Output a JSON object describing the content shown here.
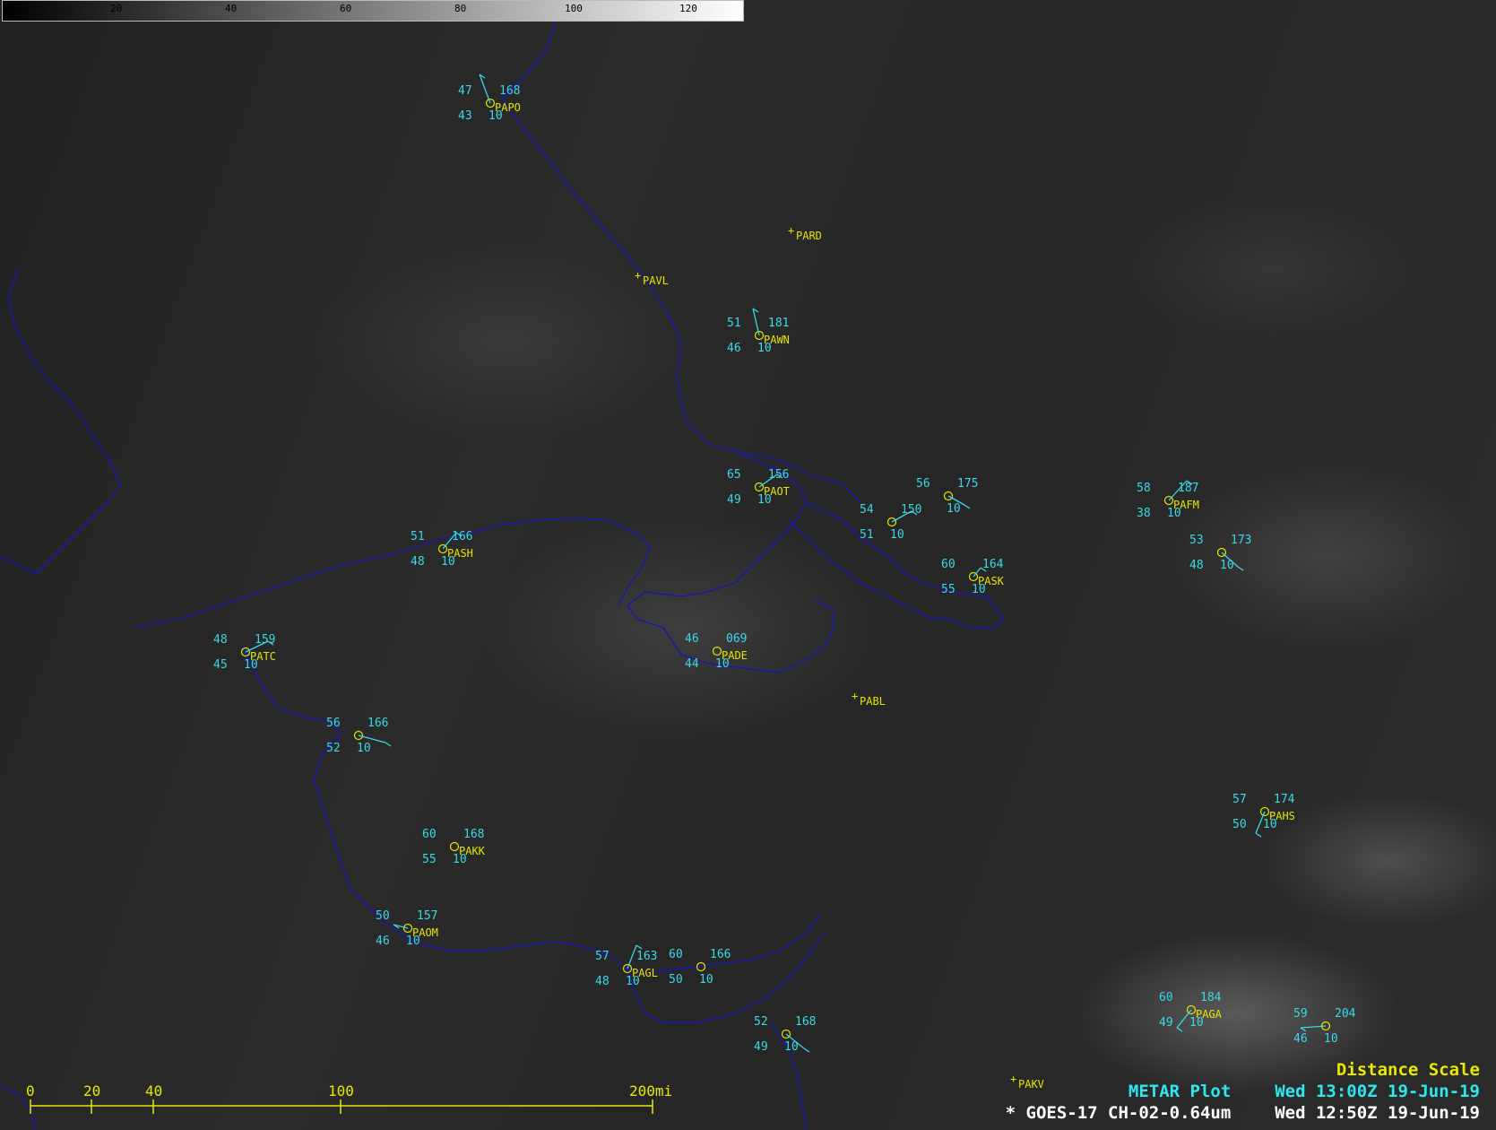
{
  "colorbar": {
    "ticks": [
      "20",
      "40",
      "60",
      "80",
      "100",
      "120"
    ]
  },
  "legend": {
    "distance_scale": "Distance Scale",
    "metar_plot": "METAR Plot",
    "metar_time": "Wed 13:00Z 19-Jun-19",
    "satellite": "* GOES-17 CH-02-0.64um",
    "satellite_time": "Wed 12:50Z 19-Jun-19"
  },
  "scale_bar": {
    "labels": [
      "0",
      "20",
      "40",
      "100",
      "200mi"
    ]
  },
  "stations": [
    {
      "id": "PAPO",
      "temp": "47",
      "dew": "43",
      "vis": "10",
      "pres": "168"
    },
    {
      "id": "PARD"
    },
    {
      "id": "PAVL"
    },
    {
      "id": "PAWN",
      "temp": "51",
      "dew": "46",
      "vis": "10",
      "pres": "181"
    },
    {
      "id": "PAOT",
      "temp": "65",
      "dew": "49",
      "vis": "10",
      "pres": "156"
    },
    {
      "temp": "56",
      "dew": "",
      "vis": "10",
      "pres": "175"
    },
    {
      "temp": "54",
      "dew": "51",
      "vis": "10",
      "pres": "150"
    },
    {
      "id": "PAFM",
      "temp": "58",
      "dew": "38",
      "vis": "10",
      "pres": "187"
    },
    {
      "temp": "53",
      "dew": "48",
      "vis": "10",
      "pres": "173"
    },
    {
      "id": "PASH",
      "temp": "51",
      "dew": "48",
      "vis": "10",
      "pres": "166"
    },
    {
      "id": "PASK",
      "temp": "60",
      "dew": "55",
      "vis": "10",
      "pres": "164"
    },
    {
      "id": "PATC",
      "temp": "48",
      "dew": "45",
      "vis": "10",
      "pres": "159"
    },
    {
      "id": "PADE",
      "temp": "46",
      "dew": "44",
      "vis": "10",
      "pres": "069"
    },
    {
      "id": "PABL"
    },
    {
      "temp": "56",
      "dew": "52",
      "vis": "10",
      "pres": "166"
    },
    {
      "id": "PAHS",
      "temp": "57",
      "dew": "50",
      "vis": "10",
      "pres": "174"
    },
    {
      "id": "PAKK",
      "temp": "60",
      "dew": "55",
      "vis": "10",
      "pres": "168"
    },
    {
      "id": "PAOM",
      "temp": "50",
      "dew": "46",
      "vis": "10",
      "pres": "157"
    },
    {
      "id": "PAGL",
      "temp": "57",
      "dew": "48",
      "vis": "10",
      "pres": "163"
    },
    {
      "temp": "60",
      "dew": "50",
      "vis": "10",
      "pres": "166"
    },
    {
      "temp": "52",
      "dew": "49",
      "vis": "10",
      "pres": "168"
    },
    {
      "id": "PAGA",
      "temp": "60",
      "dew": "49",
      "vis": "10",
      "pres": "184"
    },
    {
      "temp": "59",
      "dew": "46",
      "vis": "10",
      "pres": "204"
    },
    {
      "id": "PAKV"
    }
  ]
}
